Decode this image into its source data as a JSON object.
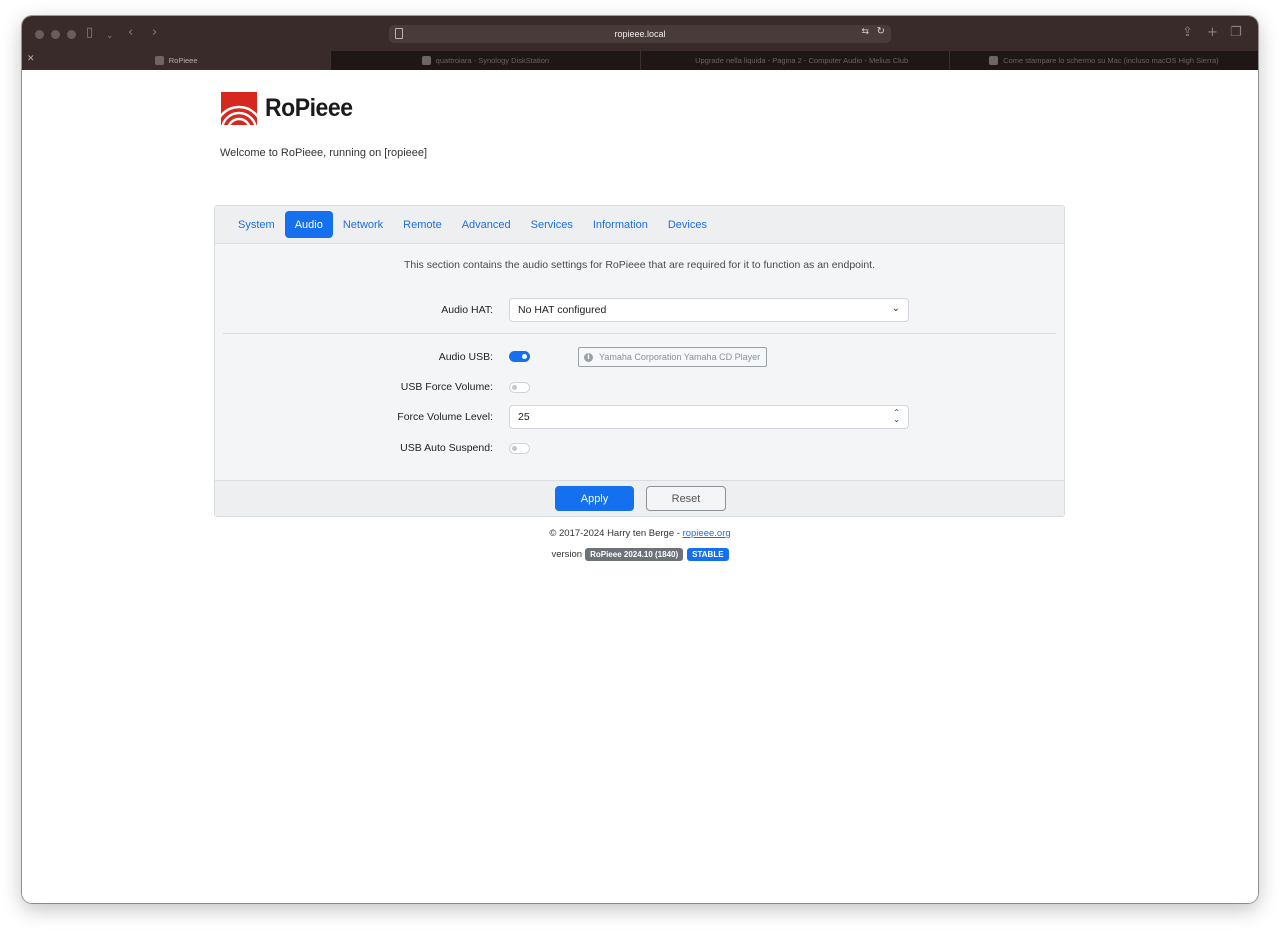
{
  "browser": {
    "address": "ropieee.local",
    "tabs": [
      {
        "title": "RoPieee",
        "active": true
      },
      {
        "title": "quattroiara - Synology DiskStation",
        "active": false
      },
      {
        "title": "Upgrade nella liquida - Pagina 2 - Computer Audio - Melius Club",
        "active": false
      },
      {
        "title": "Come stampare lo schermo su Mac (incluso macOS High Sierra)",
        "active": false
      }
    ]
  },
  "brand": {
    "name": "RoPieee",
    "welcome": "Welcome to RoPieee, running on [ropieee]"
  },
  "nav": {
    "tabs": [
      "System",
      "Audio",
      "Network",
      "Remote",
      "Advanced",
      "Services",
      "Information",
      "Devices"
    ],
    "active": "Audio"
  },
  "audio": {
    "intro": "This section contains the audio settings for RoPieee that are required for it to function as an endpoint.",
    "hat_label": "Audio HAT:",
    "hat_value": "No HAT configured",
    "usb_label": "Audio USB:",
    "usb_enabled": true,
    "usb_device": "Yamaha Corporation Yamaha CD Player",
    "force_volume_label": "USB Force Volume:",
    "force_volume_enabled": false,
    "force_level_label": "Force Volume Level:",
    "force_level_value": "25",
    "auto_suspend_label": "USB Auto Suspend:",
    "auto_suspend_enabled": false
  },
  "actions": {
    "apply": "Apply",
    "reset": "Reset"
  },
  "footer": {
    "copyright": "© 2017-2024 Harry ten Berge - ",
    "link": "ropieee.org",
    "version_label": "version",
    "version": "RoPieee 2024.10 (1840)",
    "channel": "STABLE"
  },
  "colors": {
    "accent": "#1470ef",
    "logo": "#d6281f",
    "titlebar": "#3a2b2b"
  }
}
